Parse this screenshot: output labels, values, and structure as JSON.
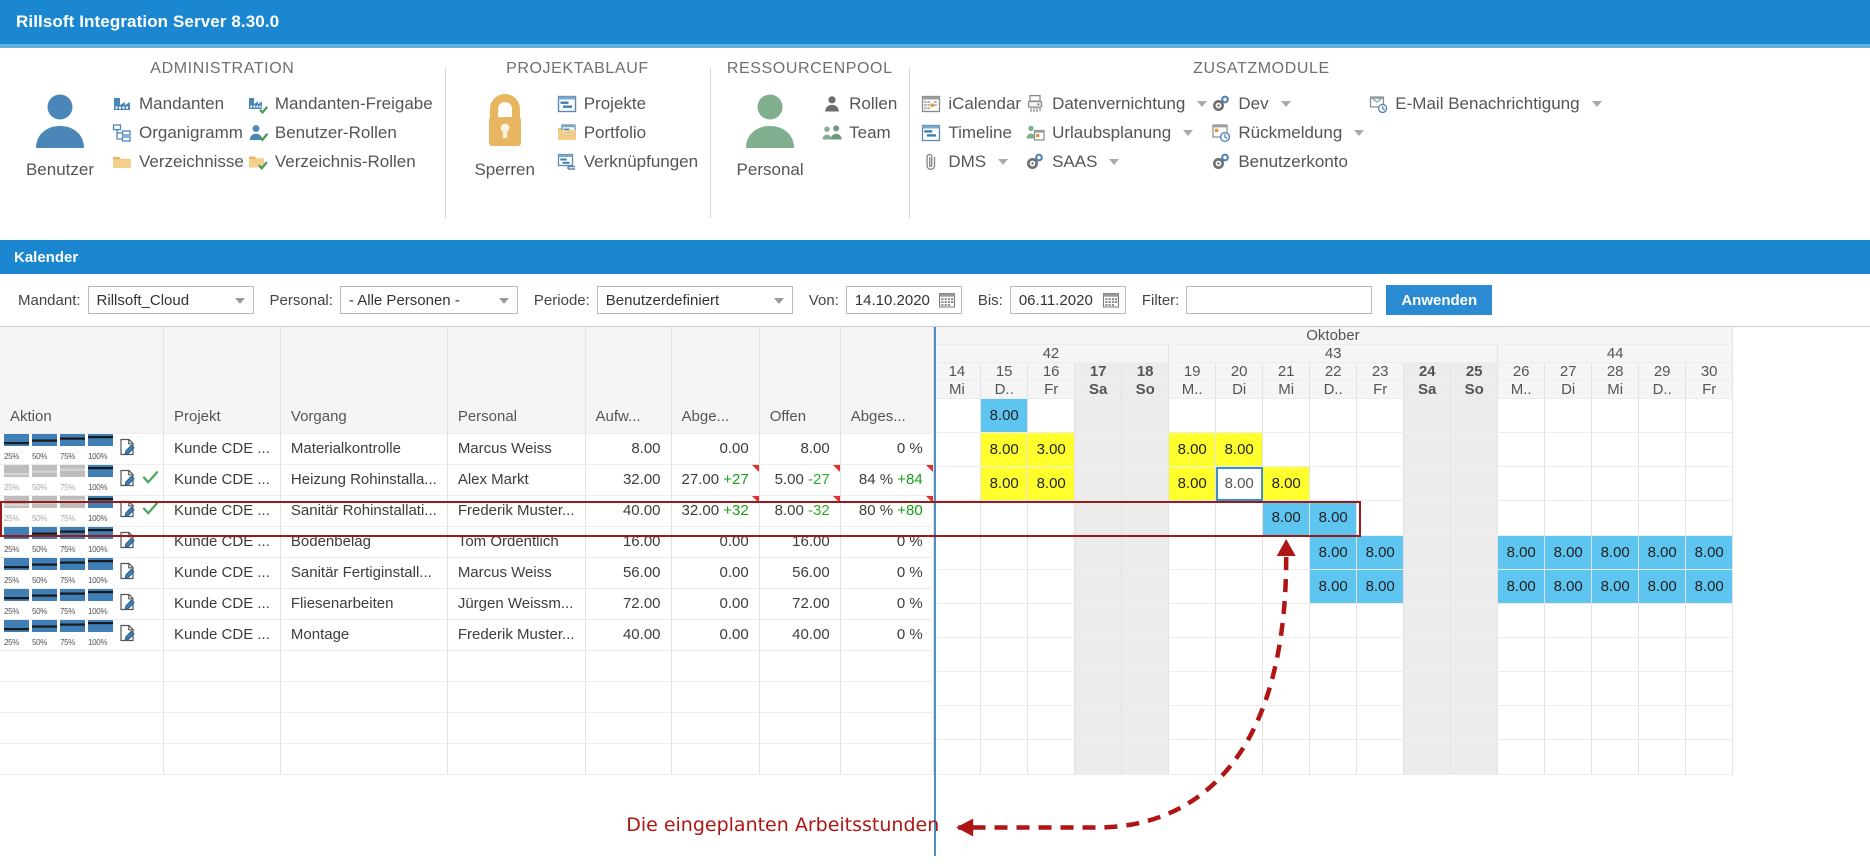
{
  "window": {
    "title": "Rillsoft Integration Server 8.30.0"
  },
  "ribbon": {
    "groups": [
      {
        "title": "ADMINISTRATION",
        "big": {
          "label": "Benutzer",
          "icon": "user-icon"
        },
        "columns": [
          [
            {
              "label": "Mandanten",
              "icon": "factory-icon"
            },
            {
              "label": "Organigramm",
              "icon": "orgchart-icon"
            },
            {
              "label": "Verzeichnisse",
              "icon": "folder-icon"
            }
          ],
          [
            {
              "label": "Mandanten-Freigabe",
              "icon": "factory-check-icon"
            },
            {
              "label": "Benutzer-Rollen",
              "icon": "user-check-icon"
            },
            {
              "label": "Verzeichnis-Rollen",
              "icon": "folder-check-icon"
            }
          ]
        ]
      },
      {
        "title": "PROJEKTABLAUF",
        "big": {
          "label": "Sperren",
          "icon": "lock-icon"
        },
        "columns": [
          [
            {
              "label": "Projekte",
              "icon": "project-icon"
            },
            {
              "label": "Portfolio",
              "icon": "portfolio-icon"
            },
            {
              "label": "Verknüpfungen",
              "icon": "link-icon"
            }
          ]
        ]
      },
      {
        "title": "RESSOURCENPOOL",
        "big": {
          "label": "Personal",
          "icon": "person-green-icon"
        },
        "columns": [
          [
            {
              "label": "Rollen",
              "icon": "role-icon"
            },
            {
              "label": "Team",
              "icon": "team-icon"
            }
          ]
        ]
      },
      {
        "title": "ZUSATZMODULE",
        "columns": [
          [
            {
              "label": "iCalendar",
              "icon": "icalendar-icon",
              "dropdown": false
            },
            {
              "label": "Timeline",
              "icon": "timeline-icon",
              "dropdown": false
            },
            {
              "label": "DMS",
              "icon": "paperclip-icon",
              "dropdown": true
            }
          ],
          [
            {
              "label": "Datenvernichtung",
              "icon": "shredder-icon",
              "dropdown": true
            },
            {
              "label": "Urlaubsplanung",
              "icon": "vacation-icon",
              "dropdown": true
            },
            {
              "label": "SAAS",
              "icon": "gears-icon",
              "dropdown": true
            }
          ],
          [
            {
              "label": "Dev",
              "icon": "gears-icon",
              "dropdown": true
            },
            {
              "label": "Rückmeldung",
              "icon": "feedback-icon",
              "dropdown": true
            },
            {
              "label": "Benutzerkonto",
              "icon": "gears-icon",
              "dropdown": false
            }
          ],
          [
            {
              "label": "E-Mail Benachrichtigung",
              "icon": "email-notify-icon",
              "dropdown": true
            }
          ]
        ]
      }
    ]
  },
  "section": {
    "title": "Kalender"
  },
  "filters": {
    "mandant_label": "Mandant:",
    "mandant_value": "Rillsoft_Cloud",
    "personal_label": "Personal:",
    "personal_value": "- Alle Personen -",
    "periode_label": "Periode:",
    "periode_value": "Benutzerdefiniert",
    "von_label": "Von:",
    "von_value": "14.10.2020",
    "bis_label": "Bis:",
    "bis_value": "06.11.2020",
    "filter_label": "Filter:",
    "filter_value": "",
    "filter_placeholder": "",
    "apply_label": "Anwenden"
  },
  "table": {
    "headers": [
      "Aktion",
      "Projekt",
      "Vorgang",
      "Personal",
      "Aufw...",
      "Abge...",
      "Offen",
      "Abges..."
    ],
    "action_steps": [
      "25%",
      "50%",
      "75%",
      "100%"
    ],
    "rows": [
      {
        "progress": 100,
        "check": false,
        "projekt": "Kunde CDE ...",
        "vorgang": "Materialkontrolle",
        "personal": "Marcus Weiss",
        "aufwand": "8.00",
        "abgeleistet": "0.00",
        "abgeleistet_delta": "",
        "offen": "8.00",
        "offen_delta": "",
        "abgeschlossen": "0 %",
        "abgeschlossen_delta": "",
        "flag": false
      },
      {
        "progress": 25,
        "check": true,
        "projekt": "Kunde CDE ...",
        "vorgang": "Heizung Rohinstalla...",
        "personal": "Alex Markt",
        "aufwand": "32.00",
        "abgeleistet": "27.00",
        "abgeleistet_delta": "+27",
        "offen": "5.00",
        "offen_delta": "-27",
        "abgeschlossen": "84 %",
        "abgeschlossen_delta": "+84",
        "flag": true
      },
      {
        "progress": 25,
        "check": true,
        "projekt": "Kunde CDE ...",
        "vorgang": "Sanitär Rohinstallati...",
        "personal": "Frederik Muster...",
        "aufwand": "40.00",
        "abgeleistet": "32.00",
        "abgeleistet_delta": "+32",
        "offen": "8.00",
        "offen_delta": "-32",
        "abgeschlossen": "80 %",
        "abgeschlossen_delta": "+80",
        "flag": true
      },
      {
        "progress": 100,
        "check": false,
        "projekt": "Kunde CDE ...",
        "vorgang": "Bodenbelag",
        "personal": "Tom Ordentlich",
        "aufwand": "16.00",
        "abgeleistet": "0.00",
        "abgeleistet_delta": "",
        "offen": "16.00",
        "offen_delta": "",
        "abgeschlossen": "0 %",
        "abgeschlossen_delta": "",
        "flag": false,
        "highlight": true
      },
      {
        "progress": 100,
        "check": false,
        "projekt": "Kunde CDE ...",
        "vorgang": "Sanitär Fertiginstall...",
        "personal": "Marcus Weiss",
        "aufwand": "56.00",
        "abgeleistet": "0.00",
        "abgeleistet_delta": "",
        "offen": "56.00",
        "offen_delta": "",
        "abgeschlossen": "0 %",
        "abgeschlossen_delta": "",
        "flag": false
      },
      {
        "progress": 100,
        "check": false,
        "projekt": "Kunde CDE ...",
        "vorgang": "Fliesenarbeiten",
        "personal": "Jürgen Weissm...",
        "aufwand": "72.00",
        "abgeleistet": "0.00",
        "abgeleistet_delta": "",
        "offen": "72.00",
        "offen_delta": "",
        "abgeschlossen": "0 %",
        "abgeschlossen_delta": "",
        "flag": false
      },
      {
        "progress": 100,
        "check": false,
        "projekt": "Kunde CDE ...",
        "vorgang": "Montage",
        "personal": "Frederik Muster...",
        "aufwand": "40.00",
        "abgeleistet": "0.00",
        "abgeleistet_delta": "",
        "offen": "40.00",
        "offen_delta": "",
        "abgeschlossen": "0 %",
        "abgeschlossen_delta": "",
        "flag": false
      }
    ]
  },
  "calendar": {
    "month": "Oktober",
    "weeks": [
      {
        "number": "42",
        "span": 5
      },
      {
        "number": "43",
        "span": 7
      },
      {
        "number": "44",
        "span": 5
      }
    ],
    "days": [
      {
        "num": "14",
        "dow": "Mi",
        "weekend": false
      },
      {
        "num": "15",
        "dow": "D..",
        "weekend": false
      },
      {
        "num": "16",
        "dow": "Fr",
        "weekend": false
      },
      {
        "num": "17",
        "dow": "Sa",
        "weekend": true
      },
      {
        "num": "18",
        "dow": "So",
        "weekend": true
      },
      {
        "num": "19",
        "dow": "M..",
        "weekend": false
      },
      {
        "num": "20",
        "dow": "Di",
        "weekend": false
      },
      {
        "num": "21",
        "dow": "Mi",
        "weekend": false
      },
      {
        "num": "22",
        "dow": "D..",
        "weekend": false
      },
      {
        "num": "23",
        "dow": "Fr",
        "weekend": false
      },
      {
        "num": "24",
        "dow": "Sa",
        "weekend": true
      },
      {
        "num": "25",
        "dow": "So",
        "weekend": true
      },
      {
        "num": "26",
        "dow": "M..",
        "weekend": false
      },
      {
        "num": "27",
        "dow": "Di",
        "weekend": false
      },
      {
        "num": "28",
        "dow": "Mi",
        "weekend": false
      },
      {
        "num": "29",
        "dow": "D..",
        "weekend": false
      },
      {
        "num": "30",
        "dow": "Fr",
        "weekend": false
      }
    ],
    "cells": [
      [
        null,
        {
          "v": "8.00",
          "s": "blue"
        },
        null,
        null,
        null,
        null,
        null,
        null,
        null,
        null,
        null,
        null,
        null,
        null,
        null,
        null,
        null
      ],
      [
        null,
        {
          "v": "8.00",
          "s": "yellow"
        },
        {
          "v": "3.00",
          "s": "yellow"
        },
        null,
        null,
        {
          "v": "8.00",
          "s": "yellow"
        },
        {
          "v": "8.00",
          "s": "yellow"
        },
        null,
        null,
        null,
        null,
        null,
        null,
        null,
        null,
        null,
        null
      ],
      [
        null,
        {
          "v": "8.00",
          "s": "yellow"
        },
        {
          "v": "8.00",
          "s": "yellow"
        },
        null,
        null,
        {
          "v": "8.00",
          "s": "yellow"
        },
        {
          "v": "8.00",
          "s": "selected"
        },
        {
          "v": "8.00",
          "s": "yellow"
        },
        null,
        null,
        null,
        null,
        null,
        null,
        null,
        null,
        null
      ],
      [
        null,
        null,
        null,
        null,
        null,
        null,
        null,
        {
          "v": "8.00",
          "s": "blue"
        },
        {
          "v": "8.00",
          "s": "blue"
        },
        null,
        null,
        null,
        null,
        null,
        null,
        null,
        null
      ],
      [
        null,
        null,
        null,
        null,
        null,
        null,
        null,
        null,
        {
          "v": "8.00",
          "s": "blue"
        },
        {
          "v": "8.00",
          "s": "blue"
        },
        null,
        null,
        {
          "v": "8.00",
          "s": "blue"
        },
        {
          "v": "8.00",
          "s": "blue"
        },
        {
          "v": "8.00",
          "s": "blue"
        },
        {
          "v": "8.00",
          "s": "blue"
        },
        {
          "v": "8.00",
          "s": "blue"
        }
      ],
      [
        null,
        null,
        null,
        null,
        null,
        null,
        null,
        null,
        {
          "v": "8.00",
          "s": "blue"
        },
        {
          "v": "8.00",
          "s": "blue"
        },
        null,
        null,
        {
          "v": "8.00",
          "s": "blue"
        },
        {
          "v": "8.00",
          "s": "blue"
        },
        {
          "v": "8.00",
          "s": "blue"
        },
        {
          "v": "8.00",
          "s": "blue"
        },
        {
          "v": "8.00",
          "s": "blue"
        }
      ],
      [
        null,
        null,
        null,
        null,
        null,
        null,
        null,
        null,
        null,
        null,
        null,
        null,
        null,
        null,
        null,
        null,
        null
      ]
    ]
  },
  "annotation": {
    "text": "Die eingeplanten Arbeitsstunden",
    "color": "#b01515"
  },
  "colors": {
    "accent": "#1b87d1",
    "blue_cell": "#5ec4f0",
    "yellow_cell": "#ffff2e",
    "weekend_col": "#ececec",
    "highlight_border": "#9b1b1b",
    "delta_green": "#18a018",
    "weekend_text": "#e81010"
  }
}
